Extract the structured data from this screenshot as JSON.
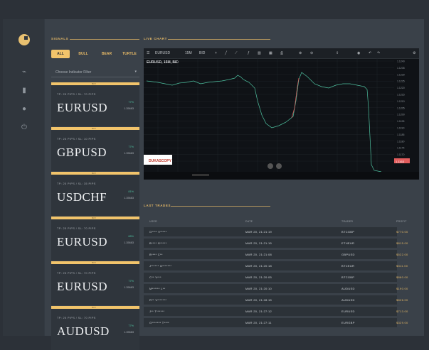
{
  "sections": {
    "signals": "SIGNALS",
    "live_chart": "LIVE CHART",
    "last_trades": "LAST TRADES"
  },
  "tabs": [
    "ALL",
    "BULL",
    "BEAR",
    "TURTLE"
  ],
  "filter": {
    "placeholder": "Choose Indicator Filter"
  },
  "cards": [
    {
      "ribbon": "BUY",
      "tp": "TP: 25 PIPS / SL: 70 PIPS",
      "pair": "EURUSD",
      "pct": "77%",
      "price": "1.35683"
    },
    {
      "ribbon": "BUY",
      "tp": "TP: 25 PIPS / SL: 10 PIPS",
      "pair": "GBPUSD",
      "pct": "77%",
      "price": "1.35683"
    },
    {
      "ribbon": "BUY",
      "tp": "TP: 25 PIPS / SL: 35 PIPS",
      "pair": "USDCHF",
      "pct": "81%",
      "price": "1.35683"
    },
    {
      "ribbon": "BUY",
      "tp": "TP: 25 PIPS / SL: 70 PIPS",
      "pair": "EURUSD",
      "pct": "68%",
      "price": "1.35683"
    },
    {
      "ribbon": "BUY",
      "tp": "TP: 25 PIPS / SL: 70 PIPS",
      "pair": "EURUSD",
      "pct": "77%",
      "price": "1.35683"
    },
    {
      "ribbon": "BUY",
      "tp": "TP: 25 PIPS / SL: 70 PIPS",
      "pair": "AUDUSD",
      "pct": "77%",
      "price": "1.35683"
    }
  ],
  "chart": {
    "symbol": "EURUSD",
    "interval": "15M",
    "side": "BID",
    "label": "EURUSD, 15M, BID",
    "watermark": "DUKASCOPY",
    "yticks": [
      "1.1240",
      "1.1235",
      "1.1230",
      "1.1225",
      "1.1220",
      "1.1215",
      "1.1210",
      "1.1205",
      "1.1200",
      "1.1195",
      "1.1190",
      "1.1185",
      "1.1180",
      "1.1175",
      "1.1170",
      "1.1165"
    ],
    "last_price": "1.1163"
  },
  "trades": {
    "headers": [
      "USER",
      "DATE",
      "TRADER",
      "PROFIT"
    ],
    "rows": [
      {
        "user": "G**** V*****",
        "date": "MAR 20, 21:21:19",
        "trader": "BTCGBP",
        "profit": "$770.00"
      },
      {
        "user": "B**** G*****",
        "date": "MAR 20, 21:21:15",
        "trader": "ETHEUR",
        "profit": "$815.00"
      },
      {
        "user": "B**** C**",
        "date": "MAR 20, 21:21:08",
        "trader": "GBPUSD",
        "profit": "$522.00"
      },
      {
        "user": "J****** G*******",
        "date": "MAR 20, 21:20:18",
        "trader": "BTCEUR",
        "profit": "$311.00"
      },
      {
        "user": "C** V***",
        "date": "MAR 20, 21:20:05",
        "trader": "BTCGBP",
        "profit": "$880.00"
      },
      {
        "user": "M****** L**",
        "date": "MAR 20, 21:20:10",
        "trader": "AUDUSD",
        "profit": "$190.00"
      },
      {
        "user": "R** V*******",
        "date": "MAR 20, 21:28:15",
        "trader": "AUDUSD",
        "profit": "$826.00"
      },
      {
        "user": "J** T******",
        "date": "MAR 20, 21:27:12",
        "trader": "EURUSD",
        "profit": "$713.00"
      },
      {
        "user": "G******* T****",
        "date": "MAR 20, 21:27:11",
        "trader": "EURGBP",
        "profit": "$329.00"
      }
    ]
  },
  "colors": {
    "accent": "#f2c46b",
    "up": "#4fc3a1",
    "down": "#e35d5d"
  }
}
